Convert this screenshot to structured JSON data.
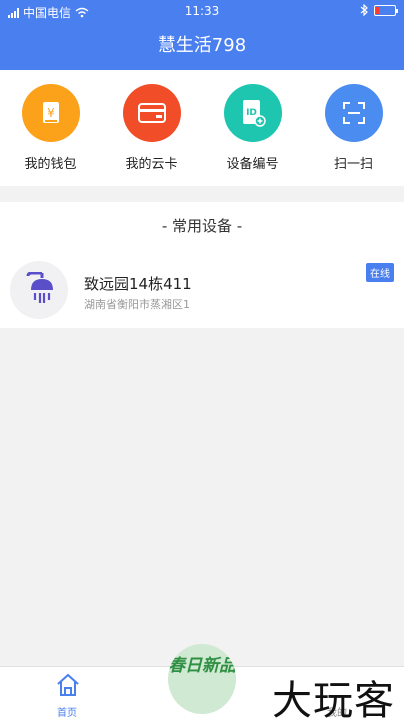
{
  "status_bar": {
    "carrier": "中国电信",
    "time": "11:33",
    "battery_percent": 10
  },
  "header": {
    "title": "慧生活798"
  },
  "shortcuts": [
    {
      "label": "我的钱包",
      "icon": "wallet-icon",
      "color": "#fca11a"
    },
    {
      "label": "我的云卡",
      "icon": "card-icon",
      "color": "#f04d28"
    },
    {
      "label": "设备编号",
      "icon": "device-id-icon",
      "color": "#1ec6b0"
    },
    {
      "label": "扫一扫",
      "icon": "scan-icon",
      "color": "#4a8cf0"
    }
  ],
  "favorites": {
    "title": "- 常用设备 -",
    "devices": [
      {
        "name": "致远园14栋411",
        "address": "湖南省衡阳市蒸湘区1",
        "status": "在线",
        "icon": "shower-icon"
      }
    ]
  },
  "tab_bar": {
    "home": "首页",
    "mine": "我的"
  },
  "promo": {
    "text": "春日新品"
  },
  "watermark": {
    "text": "大玩客"
  },
  "colors": {
    "primary": "#4a7ff0",
    "online_badge": "#4a7ff0"
  }
}
